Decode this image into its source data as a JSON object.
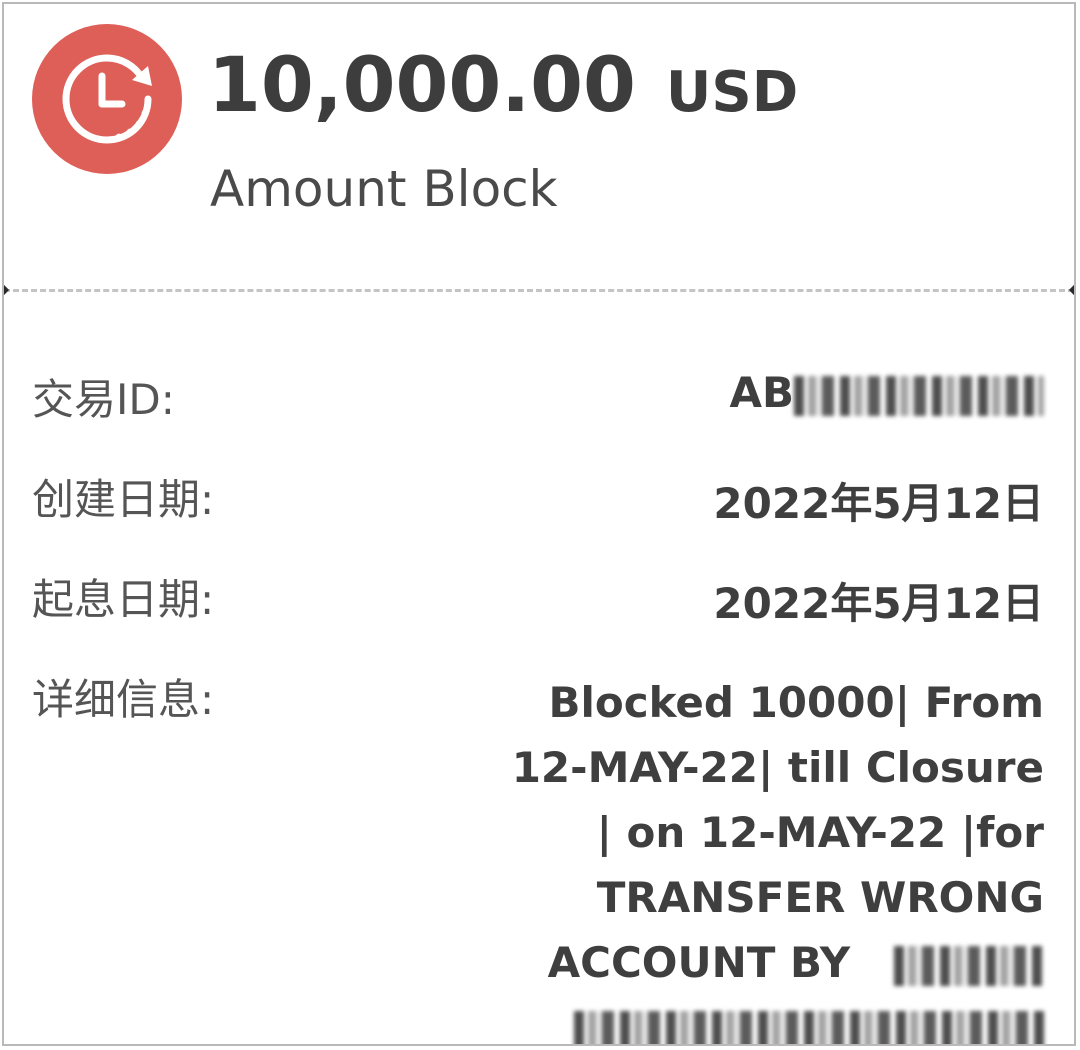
{
  "header": {
    "icon": "clock-rotate-icon",
    "amount": "10,000.00",
    "currency": "USD",
    "label": "Amount Block",
    "icon_color": "#de5f57"
  },
  "details": {
    "transaction_id": {
      "label": "交易ID:",
      "value_visible": "AB",
      "value_redacted": true
    },
    "created_date": {
      "label": "创建日期:",
      "value": "2022年5月12日"
    },
    "value_date": {
      "label": "起息日期:",
      "value": "2022年5月12日"
    },
    "info": {
      "label": "详细信息:",
      "lines": [
        "Blocked 10000| From",
        "12-MAY-22| till Closure",
        "| on 12-MAY-22 |for",
        "TRANSFER WRONG",
        "ACCOUNT BY"
      ],
      "redacted_tail": true
    }
  },
  "colors": {
    "accent": "#de5f57",
    "text_primary": "#3d3d3d",
    "text_secondary": "#555555",
    "divider": "#c4c4c4"
  }
}
